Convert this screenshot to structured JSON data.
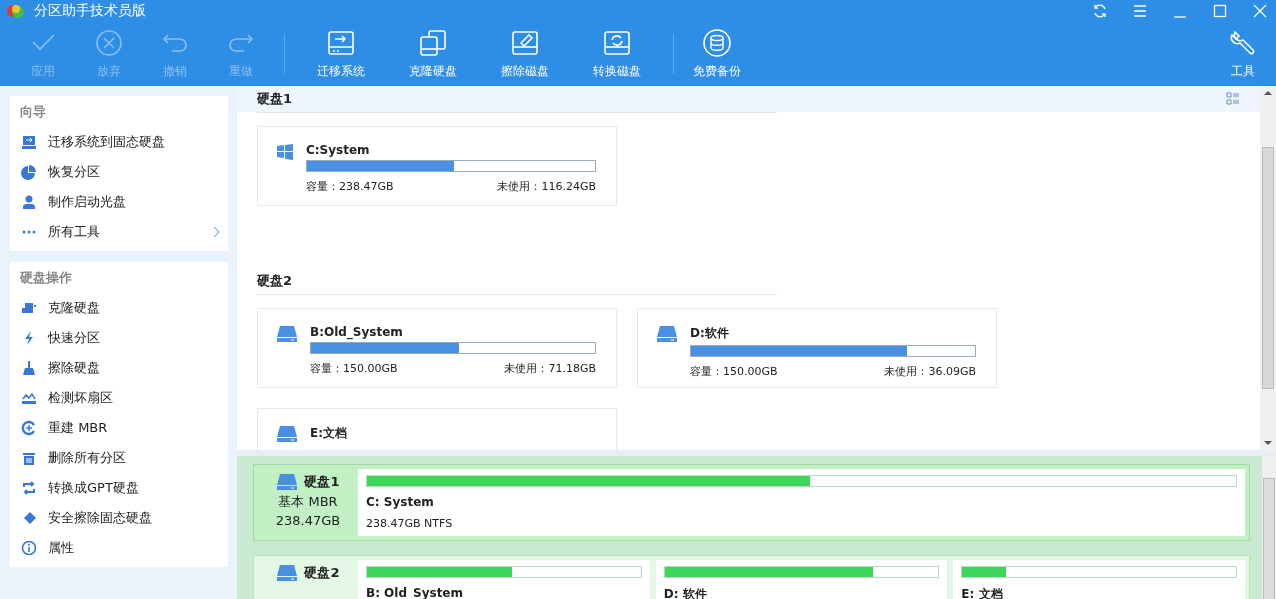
{
  "window": {
    "title": "分区助手技术员版"
  },
  "toolbar": [
    {
      "label": "应用",
      "disabled": true
    },
    {
      "label": "放弃",
      "disabled": true
    },
    {
      "label": "撤销",
      "disabled": true
    },
    {
      "label": "重做",
      "disabled": true
    },
    {
      "label": "迁移系统",
      "disabled": false
    },
    {
      "label": "克隆硬盘",
      "disabled": false
    },
    {
      "label": "擦除磁盘",
      "disabled": false
    },
    {
      "label": "转换磁盘",
      "disabled": false
    },
    {
      "label": "免费备份",
      "disabled": false
    },
    {
      "label": "工具",
      "disabled": false
    }
  ],
  "sidebar": [
    {
      "title": "向导",
      "items": [
        {
          "label": "迁移系统到固态硬盘",
          "kind": "action"
        },
        {
          "label": "恢复分区",
          "kind": "action"
        },
        {
          "label": "制作启动光盘",
          "kind": "action"
        },
        {
          "label": "所有工具",
          "kind": "submenu"
        }
      ]
    },
    {
      "title": "硬盘操作",
      "items": [
        {
          "label": "克隆硬盘",
          "kind": "action"
        },
        {
          "label": "快速分区",
          "kind": "action"
        },
        {
          "label": "擦除硬盘",
          "kind": "action"
        },
        {
          "label": "检测坏扇区",
          "kind": "action"
        },
        {
          "label": "重建 MBR",
          "kind": "action"
        },
        {
          "label": "删除所有分区",
          "kind": "action"
        },
        {
          "label": "转换成GPT硬盘",
          "kind": "action"
        },
        {
          "label": "安全擦除固态硬盘",
          "kind": "action"
        },
        {
          "label": "属性",
          "kind": "action"
        }
      ]
    }
  ],
  "disks": [
    {
      "title": "硬盘1",
      "partitions": [
        {
          "name": "C:System",
          "kind": "system",
          "level": 0.51,
          "capacity": "容量：238.47GB",
          "free": "未使用：116.24GB"
        }
      ]
    },
    {
      "title": "硬盘2",
      "partitions": [
        {
          "name": "B:Old_System",
          "kind": "drive",
          "level": 0.52,
          "capacity": "容量：150.00GB",
          "free": "未使用：71.18GB"
        },
        {
          "name": "D:软件",
          "kind": "drive",
          "level": 0.76,
          "capacity": "容量：150.00GB",
          "free": "未使用：36.09GB"
        },
        {
          "name": "E:文档",
          "kind": "drive"
        }
      ]
    }
  ],
  "disk_map": [
    {
      "name": "硬盘1",
      "type": "基本 MBR",
      "size": "238.47GB",
      "selected": true,
      "partitions": [
        {
          "label": "C: System",
          "level": 0.51,
          "info": "238.47GB NTFS"
        }
      ]
    },
    {
      "name": "硬盘2",
      "selected": false,
      "partitions": [
        {
          "label": "B: Old_System",
          "level": 0.53
        },
        {
          "label": "D: 软件",
          "level": 0.76
        },
        {
          "label": "E: 文档",
          "level": 0.16
        }
      ]
    }
  ]
}
